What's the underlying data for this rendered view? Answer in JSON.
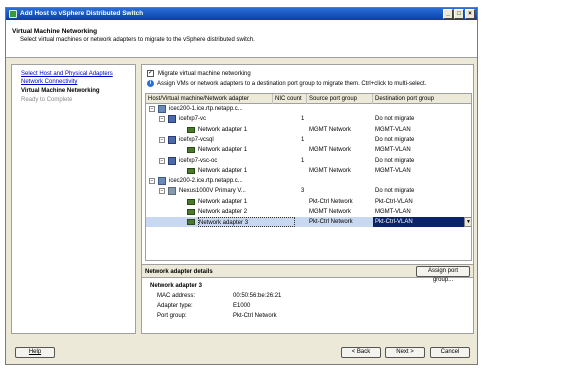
{
  "window": {
    "title": "Add Host to vSphere Distributed Switch"
  },
  "header": {
    "title": "Virtual Machine Networking",
    "subtitle": "Select virtual machines or network adapters to migrate to the vSphere distributed switch."
  },
  "steps": [
    {
      "label": "Select Host and Physical Adapters",
      "state": "link"
    },
    {
      "label": "Network Connectivity",
      "state": "link"
    },
    {
      "label": "Virtual Machine Networking",
      "state": "current"
    },
    {
      "label": "Ready to Complete",
      "state": "disabled"
    }
  ],
  "migrate": {
    "label": "Migrate virtual machine networking",
    "checked": true,
    "check_mark": "✓"
  },
  "info": {
    "text": "Assign VMs or network adapters to a destination port group to migrate them. Ctrl+click to multi-select.",
    "icon": "i"
  },
  "grid": {
    "columns": [
      "Host/Virtual machine/Network adapter",
      "NIC count",
      "Source port group",
      "Destination port group"
    ],
    "rows": [
      {
        "name": "icec200-1.ice.rtp.netapp.c...",
        "nic": "",
        "src": "",
        "dst": "",
        "level": 0,
        "icon": "host",
        "exp": "−"
      },
      {
        "name": "icefxp7-vc",
        "nic": "1",
        "src": "",
        "dst": "Do not migrate",
        "level": 1,
        "icon": "vm",
        "exp": "−"
      },
      {
        "name": "Network adapter 1",
        "nic": "",
        "src": "MGMT Network",
        "dst": "MGMT-VLAN",
        "level": 2,
        "icon": "nic",
        "exp": ""
      },
      {
        "name": "icefxp7-vcsql",
        "nic": "1",
        "src": "",
        "dst": "Do not migrate",
        "level": 1,
        "icon": "vm",
        "exp": "−"
      },
      {
        "name": "Network adapter 1",
        "nic": "",
        "src": "MGMT Network",
        "dst": "MGMT-VLAN",
        "level": 2,
        "icon": "nic",
        "exp": ""
      },
      {
        "name": "icefxp7-vsc-oc",
        "nic": "1",
        "src": "",
        "dst": "Do not migrate",
        "level": 1,
        "icon": "vm",
        "exp": "−"
      },
      {
        "name": "Network adapter 1",
        "nic": "",
        "src": "MGMT Network",
        "dst": "MGMT-VLAN",
        "level": 2,
        "icon": "nic",
        "exp": ""
      },
      {
        "name": "icec200-2.ice.rtp.netapp.c...",
        "nic": "",
        "src": "",
        "dst": "",
        "level": 0,
        "icon": "host",
        "exp": "−"
      },
      {
        "name": "Nexus1000V Primary V...",
        "nic": "3",
        "src": "",
        "dst": "Do not migrate",
        "level": 1,
        "icon": "switch",
        "exp": "−"
      },
      {
        "name": "Network adapter 1",
        "nic": "",
        "src": "Pkt-Ctrl Network",
        "dst": "Pkt-Ctrl-VLAN",
        "level": 2,
        "icon": "nic",
        "exp": ""
      },
      {
        "name": "Network adapter 2",
        "nic": "",
        "src": "MGMT Network",
        "dst": "MGMT-VLAN",
        "level": 2,
        "icon": "nic",
        "exp": ""
      },
      {
        "name": "Network adapter 3",
        "nic": "",
        "src": "Pkt-Ctrl Network",
        "dst": "Pkt-Ctrl-VLAN",
        "level": 2,
        "icon": "nic",
        "exp": "",
        "selected": true
      }
    ]
  },
  "details": {
    "header": "Network adapter details",
    "assign_button": "Assign port group...",
    "title": "Network adapter 3",
    "fields": [
      {
        "label": "MAC address:",
        "value": "00:50:56:be:26:21"
      },
      {
        "label": "Adapter type:",
        "value": "E1000"
      },
      {
        "label": "Port group:",
        "value": "Pkt-Ctrl Network"
      }
    ]
  },
  "footer": {
    "help": "Help",
    "back": "< Back",
    "next": "Next >",
    "cancel": "Cancel"
  },
  "titlebar_buttons": {
    "minimize": "_",
    "maximize": "□",
    "close": "×"
  },
  "dropdown_arrow": "▼"
}
